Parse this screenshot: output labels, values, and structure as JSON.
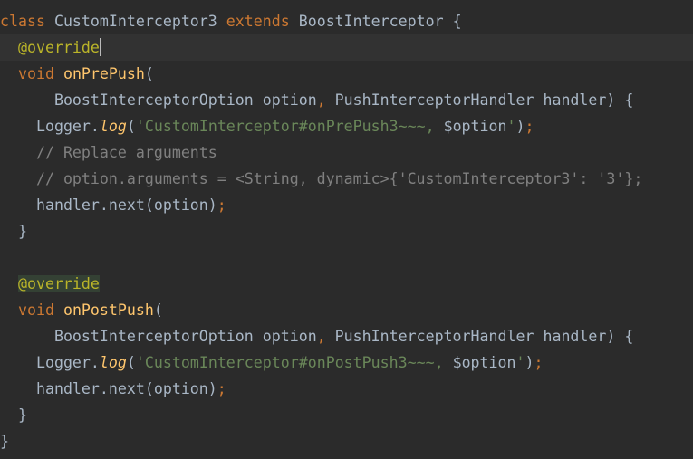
{
  "editor": {
    "colors": {
      "background": "#2b2b2b",
      "current_line": "#323232",
      "keyword": "#cc7832",
      "annotation": "#bbb529",
      "function": "#ffc66d",
      "string": "#6a8759",
      "comment": "#808080",
      "default": "#a9b7c6"
    },
    "lines": [
      [
        {
          "t": "class",
          "k": "kw"
        },
        {
          "t": " ",
          "k": "id"
        },
        {
          "t": "CustomInterceptor3",
          "k": "type"
        },
        {
          "t": " ",
          "k": "id"
        },
        {
          "t": "extends",
          "k": "kw"
        },
        {
          "t": " ",
          "k": "id"
        },
        {
          "t": "BoostInterceptor",
          "k": "type"
        },
        {
          "t": " {",
          "k": "punct"
        }
      ],
      [
        {
          "t": "  ",
          "k": "id"
        },
        {
          "t": "@override",
          "k": "ann",
          "caret": true
        }
      ],
      [
        {
          "t": "  ",
          "k": "id"
        },
        {
          "t": "void",
          "k": "kw"
        },
        {
          "t": " ",
          "k": "id"
        },
        {
          "t": "onPrePush",
          "k": "fn"
        },
        {
          "t": "(",
          "k": "punct"
        }
      ],
      [
        {
          "t": "      ",
          "k": "id"
        },
        {
          "t": "BoostInterceptorOption",
          "k": "type"
        },
        {
          "t": " option",
          "k": "id"
        },
        {
          "t": ",",
          "k": "sep"
        },
        {
          "t": " PushInterceptorHandler",
          "k": "type"
        },
        {
          "t": " handler) {",
          "k": "id"
        }
      ],
      [
        {
          "t": "    ",
          "k": "id"
        },
        {
          "t": "Logger",
          "k": "type"
        },
        {
          "t": ".",
          "k": "punct"
        },
        {
          "t": "log",
          "k": "method-it"
        },
        {
          "t": "(",
          "k": "punct"
        },
        {
          "t": "'CustomInterceptor#onPrePush3~~~, ",
          "k": "str"
        },
        {
          "t": "$option",
          "k": "interp"
        },
        {
          "t": "'",
          "k": "str"
        },
        {
          "t": ")",
          "k": "punct"
        },
        {
          "t": ";",
          "k": "sep"
        }
      ],
      [
        {
          "t": "    ",
          "k": "id"
        },
        {
          "t": "// Replace arguments",
          "k": "cmt"
        }
      ],
      [
        {
          "t": "    ",
          "k": "id"
        },
        {
          "t": "// option.arguments = <String, dynamic>{'CustomInterceptor3': '3'};",
          "k": "cmt"
        }
      ],
      [
        {
          "t": "    ",
          "k": "id"
        },
        {
          "t": "handler.next(option)",
          "k": "id"
        },
        {
          "t": ";",
          "k": "sep"
        }
      ],
      [
        {
          "t": "  }",
          "k": "punct"
        }
      ],
      [],
      [
        {
          "t": "  ",
          "k": "id"
        },
        {
          "t": "@override",
          "k": "ann-hl"
        }
      ],
      [
        {
          "t": "  ",
          "k": "id"
        },
        {
          "t": "void",
          "k": "kw"
        },
        {
          "t": " ",
          "k": "id"
        },
        {
          "t": "onPostPush",
          "k": "fn"
        },
        {
          "t": "(",
          "k": "punct"
        }
      ],
      [
        {
          "t": "      ",
          "k": "id"
        },
        {
          "t": "BoostInterceptorOption",
          "k": "type"
        },
        {
          "t": " option",
          "k": "id"
        },
        {
          "t": ",",
          "k": "sep"
        },
        {
          "t": " PushInterceptorHandler",
          "k": "type"
        },
        {
          "t": " handler) {",
          "k": "id"
        }
      ],
      [
        {
          "t": "    ",
          "k": "id"
        },
        {
          "t": "Logger",
          "k": "type"
        },
        {
          "t": ".",
          "k": "punct"
        },
        {
          "t": "log",
          "k": "method-it"
        },
        {
          "t": "(",
          "k": "punct"
        },
        {
          "t": "'CustomInterceptor#onPostPush3~~~, ",
          "k": "str"
        },
        {
          "t": "$option",
          "k": "interp"
        },
        {
          "t": "'",
          "k": "str"
        },
        {
          "t": ")",
          "k": "punct"
        },
        {
          "t": ";",
          "k": "sep"
        }
      ],
      [
        {
          "t": "    ",
          "k": "id"
        },
        {
          "t": "handler.next(option)",
          "k": "id"
        },
        {
          "t": ";",
          "k": "sep"
        }
      ],
      [
        {
          "t": "  }",
          "k": "punct"
        }
      ],
      [
        {
          "t": "}",
          "k": "punct"
        }
      ]
    ],
    "current_line_index": 1
  }
}
